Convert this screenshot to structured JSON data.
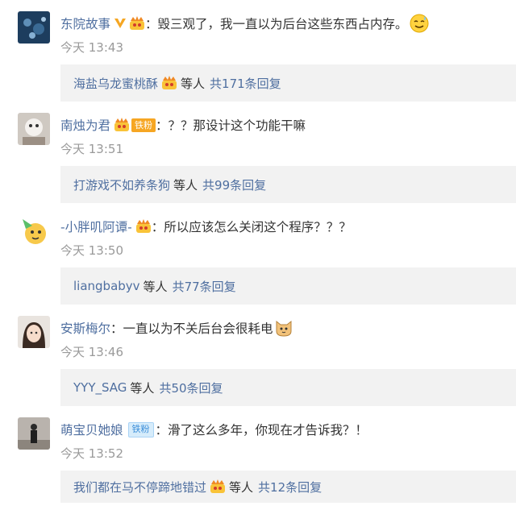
{
  "comments": [
    {
      "username": "东院故事",
      "text": "：毁三观了，我一直以为后台这些东西占内存。",
      "time": "今天 13:43",
      "reply_user": "海盐乌龙蜜桃酥",
      "reply_mid": "等人",
      "reply_count": "共171条回复"
    },
    {
      "username": "南烛为君",
      "fan_badge": "铁粉",
      "text": "：？？那设计这个功能干嘛",
      "time": "今天 13:51",
      "reply_user": "打游戏不如养条狗",
      "reply_mid": "等人",
      "reply_count": "共99条回复"
    },
    {
      "username": "-小胖叽阿谭-",
      "text": "：所以应该怎么关闭这个程序？？？",
      "time": "今天 13:50",
      "reply_user": "liangbabyv",
      "reply_mid": "等人",
      "reply_count": "共77条回复"
    },
    {
      "username": "安斯梅尔",
      "text": "：一直以为不关后台会很耗电",
      "time": "今天 13:46",
      "reply_user": "YYY_SAG",
      "reply_mid": "等人",
      "reply_count": "共50条回复"
    },
    {
      "username": "萌宝贝她娘",
      "fan_badge": "铁粉",
      "text": "：滑了这么多年，你现在才告诉我？！",
      "time": "今天 13:52",
      "reply_user": "我们都在马不停蹄地错过",
      "reply_mid": "等人",
      "reply_count": "共12条回复"
    }
  ],
  "colors": {
    "username": "#4f6fa0",
    "text": "#333333",
    "time": "#9a9a9a",
    "reply_bg": "#f2f2f2",
    "fan_gold": "#f6a623",
    "fan_blue": "#3c8ed9"
  }
}
